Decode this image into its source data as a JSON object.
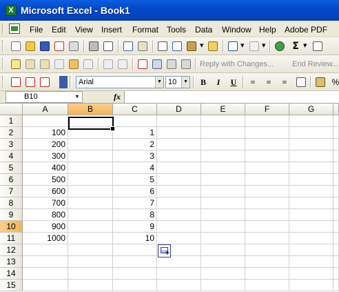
{
  "window": {
    "title": "Microsoft Excel - Book1",
    "app_icon_letter": "X"
  },
  "menu": [
    "File",
    "Edit",
    "View",
    "Insert",
    "Format",
    "Tools",
    "Data",
    "Window",
    "Help",
    "Adobe PDF"
  ],
  "toolbar_reviewing": {
    "reply_label": "Reply with Changes...",
    "end_review_label": "End Review..."
  },
  "formatting": {
    "font_name": "Arial",
    "font_size": "10",
    "bold": "B",
    "italic": "I",
    "underline": "U",
    "percent": "%"
  },
  "formula_bar": {
    "name_box": "B10",
    "fx": "fx",
    "formula": ""
  },
  "sheet": {
    "columns": [
      "A",
      "B",
      "C",
      "D",
      "E",
      "F",
      "G"
    ],
    "selected_column": "B",
    "selected_row": "10",
    "rows": [
      {
        "n": "1",
        "A": "",
        "C": ""
      },
      {
        "n": "2",
        "A": "100",
        "C": "1"
      },
      {
        "n": "3",
        "A": "200",
        "C": "2"
      },
      {
        "n": "4",
        "A": "300",
        "C": "3"
      },
      {
        "n": "5",
        "A": "400",
        "C": "4"
      },
      {
        "n": "6",
        "A": "500",
        "C": "5"
      },
      {
        "n": "7",
        "A": "600",
        "C": "6"
      },
      {
        "n": "8",
        "A": "700",
        "C": "7"
      },
      {
        "n": "9",
        "A": "800",
        "C": "8"
      },
      {
        "n": "10",
        "A": "900",
        "C": "9"
      },
      {
        "n": "11",
        "A": "1000",
        "C": "10"
      },
      {
        "n": "12",
        "A": "",
        "C": ""
      },
      {
        "n": "13",
        "A": "",
        "C": ""
      },
      {
        "n": "14",
        "A": "",
        "C": ""
      },
      {
        "n": "15",
        "A": "",
        "C": ""
      }
    ]
  },
  "colors": {
    "titlebar": "#0349c8",
    "selected_header": "#f3b35a",
    "excel_green": "#1e7a2e"
  }
}
